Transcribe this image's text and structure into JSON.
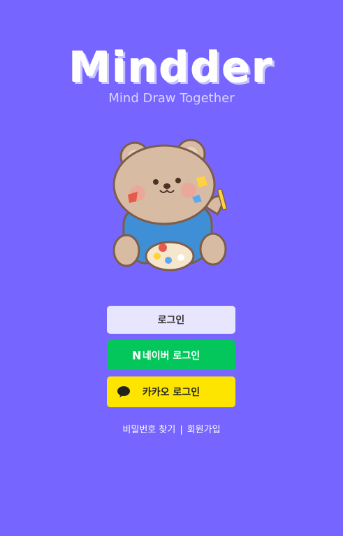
{
  "brand": {
    "logo": "Mindder",
    "tagline": "Mind Draw Together"
  },
  "illustration": {
    "description_icon": "bear-painter-icon"
  },
  "buttons": {
    "login": "로그인",
    "naver": "네이버 로그인",
    "naver_icon": "N",
    "kakao": "카카오 로그인"
  },
  "links": {
    "find_password": "비밀번호 찾기",
    "separator": "|",
    "signup": "회원가입"
  },
  "colors": {
    "background": "#7666FF",
    "naver": "#03C75A",
    "kakao": "#FEE500",
    "login": "#E8E6FF"
  }
}
